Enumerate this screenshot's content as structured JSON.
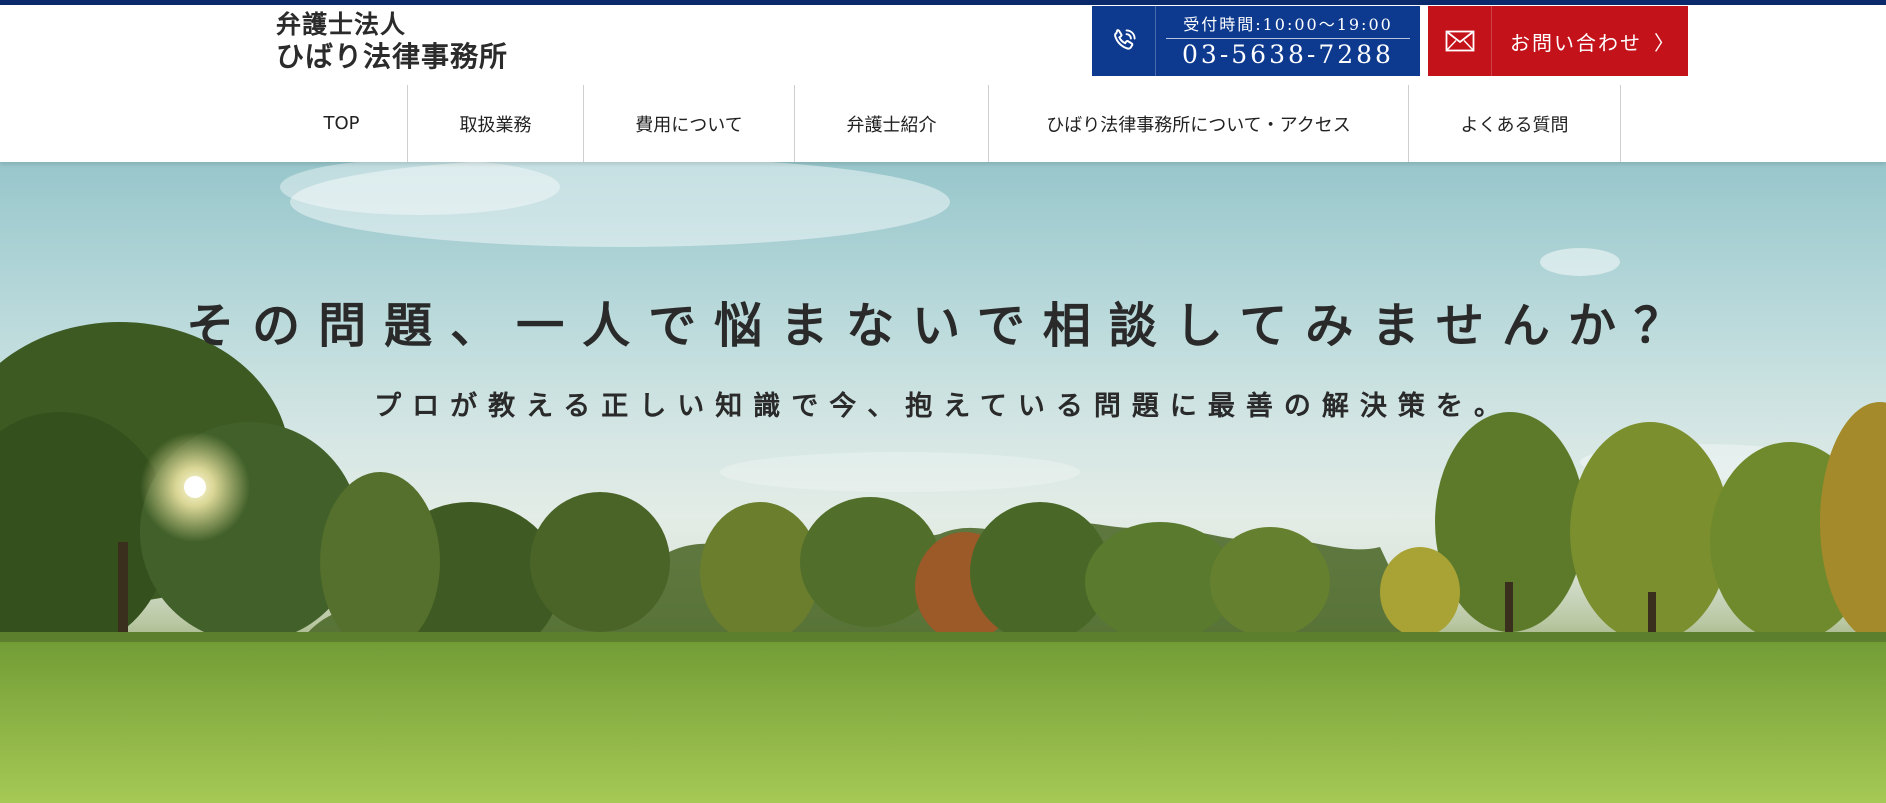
{
  "header": {
    "logo_line1": "弁護士法人",
    "logo_line2": "ひばり法律事務所",
    "tel": {
      "icon": "phone-icon",
      "hours": "受付時間:10:00〜19:00",
      "number": "03-5638-7288"
    },
    "contact": {
      "icon": "mail-icon",
      "label": "お問い合わせ",
      "chevron": "〉"
    }
  },
  "nav": {
    "items": [
      {
        "label": "TOP"
      },
      {
        "label": "取扱業務"
      },
      {
        "label": "費用について"
      },
      {
        "label": "弁護士紹介"
      },
      {
        "label": "ひばり法律事務所について・アクセス"
      },
      {
        "label": "よくある質問"
      }
    ]
  },
  "hero": {
    "headline": "その問題、一人で悩まないで相談してみませんか？",
    "subline": "プロが教える正しい知識で今、抱えている問題に最善の解決策を。"
  },
  "colors": {
    "tel_bg": "#0d3a8f",
    "contact_bg": "#c4121b",
    "top_stripe": "#0b2a6b"
  }
}
